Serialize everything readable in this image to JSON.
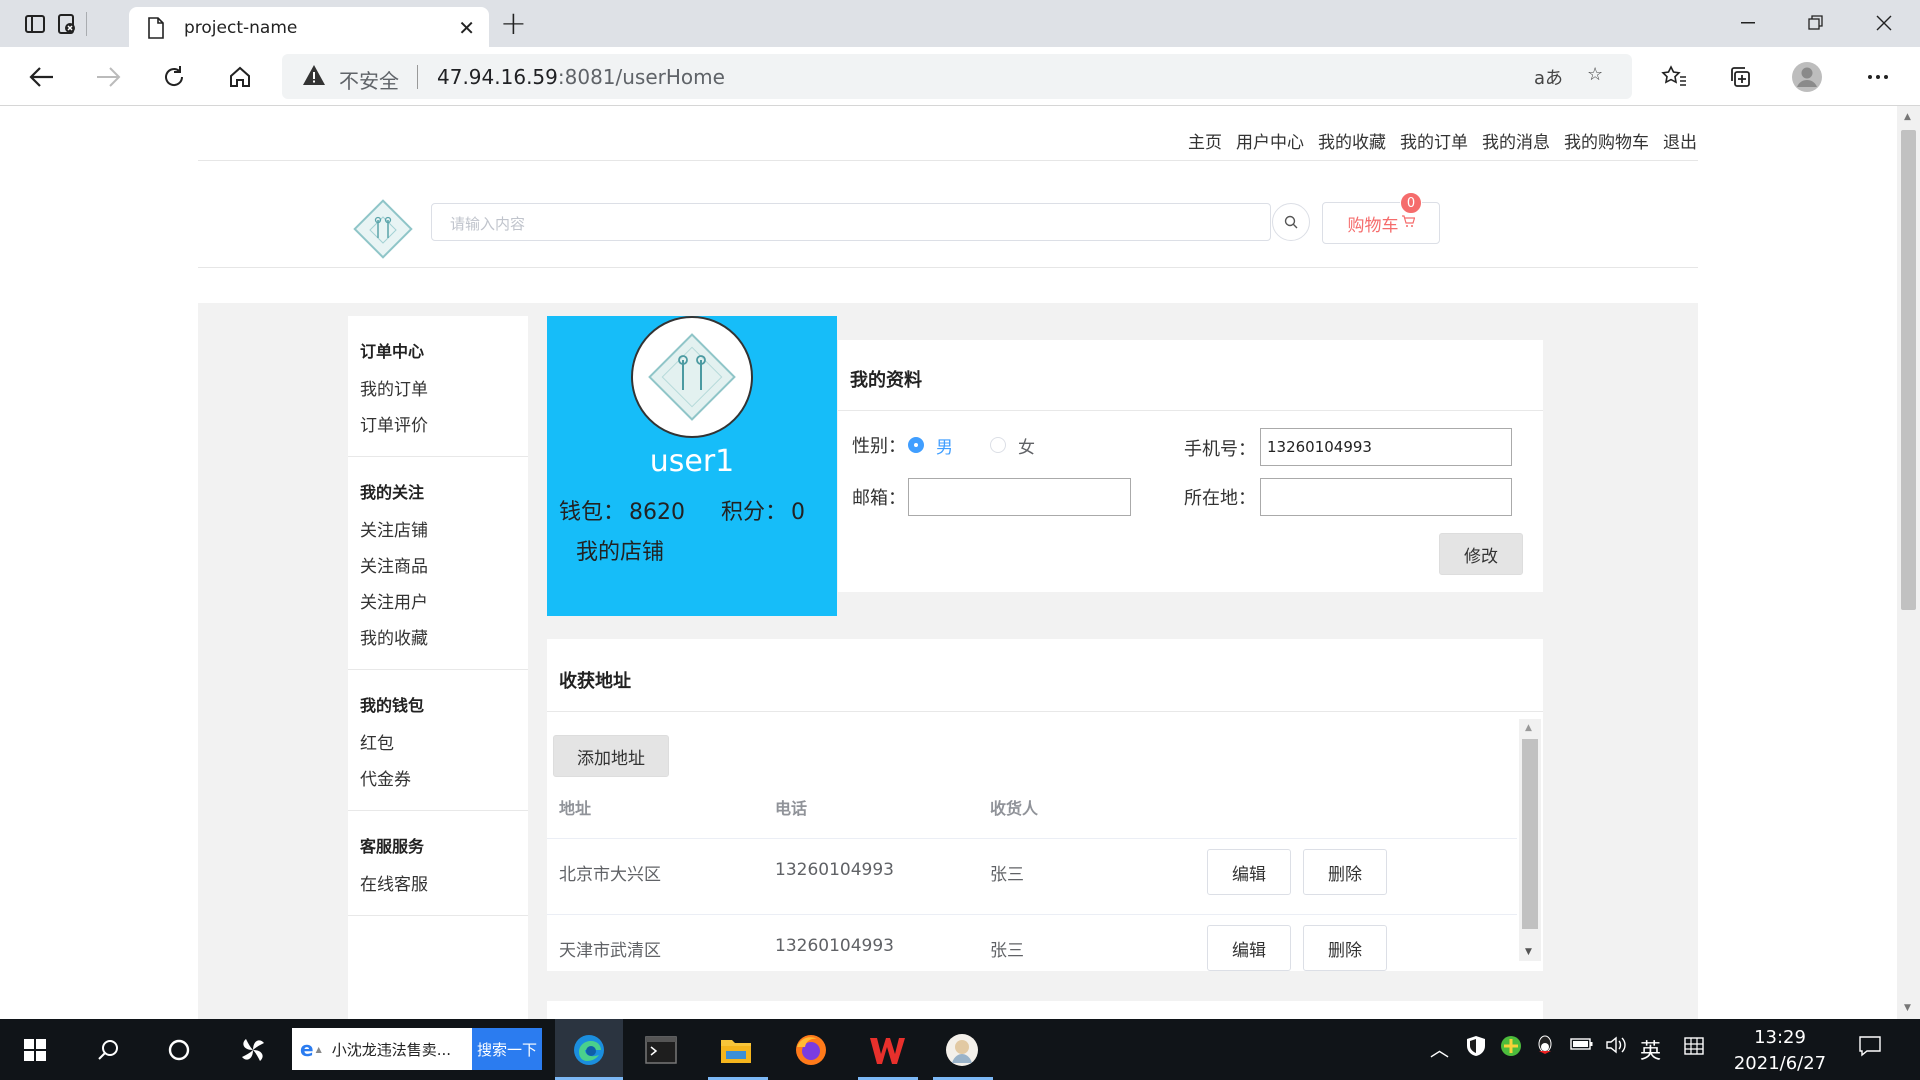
{
  "browser": {
    "tab_title": "project-name",
    "insecure_label": "不安全",
    "url_host": "47.94.16.59",
    "url_port": ":8081",
    "url_path": "/userHome"
  },
  "topnav": [
    "主页",
    "用户中心",
    "我的收藏",
    "我的订单",
    "我的消息",
    "我的购物车",
    "退出"
  ],
  "search": {
    "placeholder": "请输入内容"
  },
  "cart": {
    "label": "购物车",
    "count": "0"
  },
  "sidebar": [
    {
      "title": "订单中心",
      "items": [
        "我的订单",
        "订单评价"
      ]
    },
    {
      "title": "我的关注",
      "items": [
        "关注店铺",
        "关注商品",
        "关注用户",
        "我的收藏"
      ]
    },
    {
      "title": "我的钱包",
      "items": [
        "红包",
        "代金券"
      ]
    },
    {
      "title": "客服服务",
      "items": [
        "在线客服"
      ]
    }
  ],
  "profile": {
    "username": "user1",
    "wallet_label": "钱包：",
    "wallet_value": "8620",
    "points_label": "积分：",
    "points_value": "0",
    "shop_link": "我的店铺"
  },
  "info": {
    "title": "我的资料",
    "gender_label": "性别：",
    "gender_male": "男",
    "gender_female": "女",
    "gender_selected": "男",
    "phone_label": "手机号：",
    "phone_value": "13260104993",
    "email_label": "邮箱：",
    "email_value": "",
    "location_label": "所在地：",
    "location_value": "",
    "submit_label": "修改"
  },
  "addresses": {
    "title": "收获地址",
    "add_label": "添加地址",
    "columns": [
      "地址",
      "电话",
      "收货人"
    ],
    "rows": [
      {
        "address": "北京市大兴区",
        "phone": "13260104993",
        "receiver": "张三"
      },
      {
        "address": "天津市武清区",
        "phone": "13260104993",
        "receiver": "张三"
      }
    ],
    "edit_label": "编辑",
    "delete_label": "删除"
  },
  "taskbar": {
    "search_text": "小沈龙违法售卖...",
    "search_button": "搜索一下",
    "ime_lang": "英",
    "time": "13:29",
    "date": "2021/6/27"
  },
  "colors": {
    "profile_card": "#16bdf9",
    "accent": "#409eff",
    "cart": "#f56c6c"
  }
}
